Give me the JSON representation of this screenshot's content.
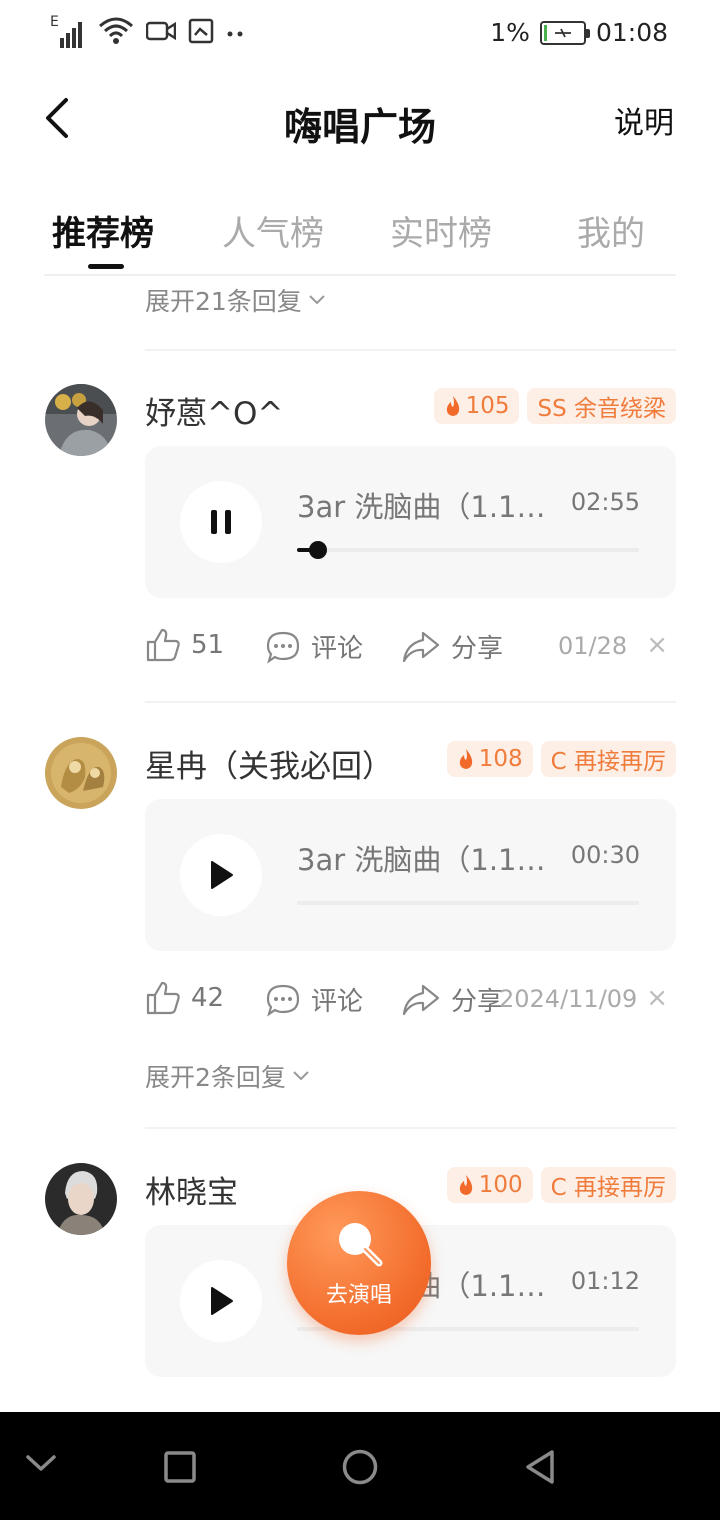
{
  "status_bar": {
    "signal_label": "E",
    "battery_percent": "1%",
    "time": "01:08",
    "icons": [
      "signal-icon",
      "wifi-icon",
      "video-icon",
      "screenshot-icon",
      "more-dots-icon",
      "battery-charging-icon"
    ]
  },
  "header": {
    "title": "嗨唱广场",
    "explain_label": "说明",
    "back_icon": "back-arrow-icon"
  },
  "tabs": [
    {
      "label": "推荐榜",
      "active": true
    },
    {
      "label": "人气榜",
      "active": false
    },
    {
      "label": "实时榜",
      "active": false
    },
    {
      "label": "我的",
      "active": false
    }
  ],
  "feed": {
    "top_expand": "展开21条回复",
    "posts": [
      {
        "username": "妤蒽^O^",
        "heat": "105",
        "rank_badge": "SS 余音绕梁",
        "song": "3ar 洗脑曲（1.1x...",
        "duration": "02:55",
        "playing": true,
        "progress": 0.06,
        "likes": "51",
        "comment_label": "评论",
        "share_label": "分享",
        "date": "01/28"
      },
      {
        "username": "星冉（关我必回）",
        "heat": "108",
        "rank_badge": "C 再接再厉",
        "song": "3ar 洗脑曲（1.1x...",
        "duration": "00:30",
        "playing": false,
        "progress": 0,
        "likes": "42",
        "comment_label": "评论",
        "share_label": "分享",
        "date": "2024/11/09",
        "expand": "展开2条回复"
      },
      {
        "username": "林晓宝",
        "heat": "100",
        "rank_badge": "C 再接再厉",
        "song": "3ar 洗脑曲（1.1x...",
        "duration": "01:12",
        "playing": false,
        "progress": 0
      }
    ]
  },
  "fab": {
    "label": "去演唱",
    "icon": "microphone-icon"
  },
  "close_glyph": "×",
  "colors": {
    "accent": "#f26a2a",
    "badge_bg": "#fdeee6",
    "badge_text": "#f07c3c"
  }
}
